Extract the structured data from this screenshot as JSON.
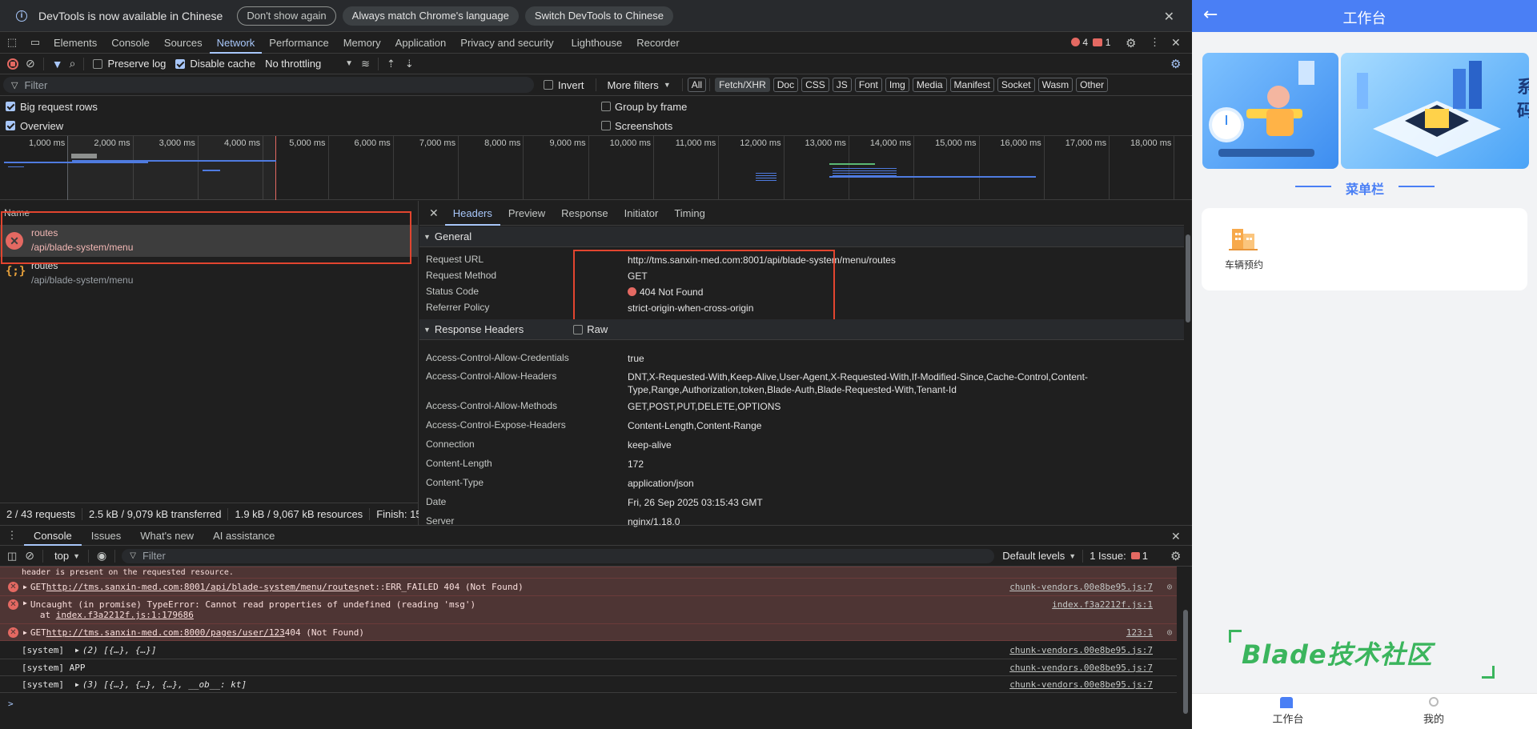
{
  "infobar": {
    "message": "DevTools is now available in Chinese",
    "dont_show": "Don't show again",
    "always_match": "Always match Chrome's language",
    "switch": "Switch DevTools to Chinese"
  },
  "tabs": [
    "Elements",
    "Console",
    "Sources",
    "Network",
    "Performance",
    "Memory",
    "Application",
    "Privacy and security",
    "Lighthouse",
    "Recorder"
  ],
  "badges": {
    "errors": "4",
    "issues": "1"
  },
  "toolbar": {
    "preserve_log": "Preserve log",
    "disable_cache": "Disable cache",
    "throttling": "No throttling"
  },
  "filter": {
    "placeholder": "Filter",
    "invert": "Invert",
    "more_filters": "More filters",
    "types": [
      "All",
      "Fetch/XHR",
      "Doc",
      "CSS",
      "JS",
      "Font",
      "Img",
      "Media",
      "Manifest",
      "Socket",
      "Wasm",
      "Other"
    ]
  },
  "options": {
    "big_rows": "Big request rows",
    "group_by_frame": "Group by frame",
    "overview": "Overview",
    "screenshots": "Screenshots"
  },
  "timeline_ticks": [
    "1,000 ms",
    "2,000 ms",
    "3,000 ms",
    "4,000 ms",
    "5,000 ms",
    "6,000 ms",
    "7,000 ms",
    "8,000 ms",
    "9,000 ms",
    "10,000 ms",
    "11,000 ms",
    "12,000 ms",
    "13,000 ms",
    "14,000 ms",
    "15,000 ms",
    "16,000 ms",
    "17,000 ms",
    "18,000 ms"
  ],
  "requests": {
    "header": "Name",
    "rows": [
      {
        "name": "routes",
        "path": "/api/blade-system/menu",
        "status": "error"
      },
      {
        "name": "routes",
        "path": "/api/blade-system/menu",
        "status": "json"
      }
    ]
  },
  "status_bar": {
    "requests": "2 / 43 requests",
    "transferred": "2.5 kB / 9,079 kB transferred",
    "resources": "1.9 kB / 9,067 kB resources",
    "finish": "Finish: 15."
  },
  "detail_tabs": [
    "Headers",
    "Preview",
    "Response",
    "Initiator",
    "Timing"
  ],
  "general": {
    "title": "General",
    "rows": [
      {
        "k": "Request URL",
        "v": "http://tms.sanxin-med.com:8001/api/blade-system/menu/routes"
      },
      {
        "k": "Request Method",
        "v": "GET"
      },
      {
        "k": "Status Code",
        "v": "404 Not Found"
      },
      {
        "k": "Referrer Policy",
        "v": "strict-origin-when-cross-origin"
      }
    ]
  },
  "response_headers": {
    "title": "Response Headers",
    "raw": "Raw",
    "rows": [
      {
        "k": "Access-Control-Allow-Credentials",
        "v": "true"
      },
      {
        "k": "Access-Control-Allow-Headers",
        "v": "DNT,X-Requested-With,Keep-Alive,User-Agent,X-Requested-With,If-Modified-Since,Cache-Control,Content-Type,Range,Authorization,token,Blade-Auth,Blade-Requested-With,Tenant-Id"
      },
      {
        "k": "Access-Control-Allow-Methods",
        "v": "GET,POST,PUT,DELETE,OPTIONS"
      },
      {
        "k": "Access-Control-Expose-Headers",
        "v": "Content-Length,Content-Range"
      },
      {
        "k": "Connection",
        "v": "keep-alive"
      },
      {
        "k": "Content-Length",
        "v": "172"
      },
      {
        "k": "Content-Type",
        "v": "application/json"
      },
      {
        "k": "Date",
        "v": "Fri, 26 Sep 2025 03:15:43 GMT"
      },
      {
        "k": "Server",
        "v": "nginx/1.18.0"
      }
    ]
  },
  "console": {
    "tabs": [
      "Console",
      "Issues",
      "What's new",
      "AI assistance"
    ],
    "context": "top",
    "filter_placeholder": "Filter",
    "levels": "Default levels",
    "issues": "1 Issue:",
    "issues_count": "1",
    "cut_line": "header is present on the requested resource.",
    "lines": [
      {
        "type": "error",
        "prefix": "GET ",
        "link": "http://tms.sanxin-med.com:8001/api/blade-system/menu/routes",
        "suffix": " net::ERR_FAILED 404 (Not Found)",
        "source": "chunk-vendors.00e8be95.js:7"
      },
      {
        "type": "error",
        "prefix": "Uncaught (in promise) TypeError: Cannot read properties of undefined (reading 'msg')",
        "link": "",
        "suffix": "",
        "at": "at ",
        "at_link": "index.f3a2212f.js:1:179686",
        "source": "index.f3a2212f.js:1"
      },
      {
        "type": "error",
        "prefix": "GET ",
        "link": "http://tms.sanxin-med.com:8000/pages/user/123",
        "suffix": " 404 (Not Found)",
        "source": "123:1"
      },
      {
        "type": "log",
        "prefix": "[system]",
        "body": "(2) [{…}, {…}]",
        "source": "chunk-vendors.00e8be95.js:7"
      },
      {
        "type": "log",
        "prefix": "[system] APP",
        "body": "",
        "source": "chunk-vendors.00e8be95.js:7"
      },
      {
        "type": "log",
        "prefix": "[system]",
        "body": "(3) [{…}, {…}, {…}, __ob__: kt]",
        "source": "chunk-vendors.00e8be95.js:7"
      }
    ],
    "prompt": ">"
  },
  "phone": {
    "title": "工作台",
    "section_title": "菜单栏",
    "menu_items": [
      {
        "label": "车辆预约",
        "icon": "building-icon"
      }
    ],
    "banner_text": "系\n码",
    "watermark": "Blade技术社区",
    "tabbar": [
      {
        "label": "工作台",
        "active": true
      },
      {
        "label": "我的",
        "active": false
      }
    ],
    "colors": {
      "header": "#4a7ff5",
      "accent": "#4a7ff5",
      "watermark": "#3bb55d"
    }
  }
}
